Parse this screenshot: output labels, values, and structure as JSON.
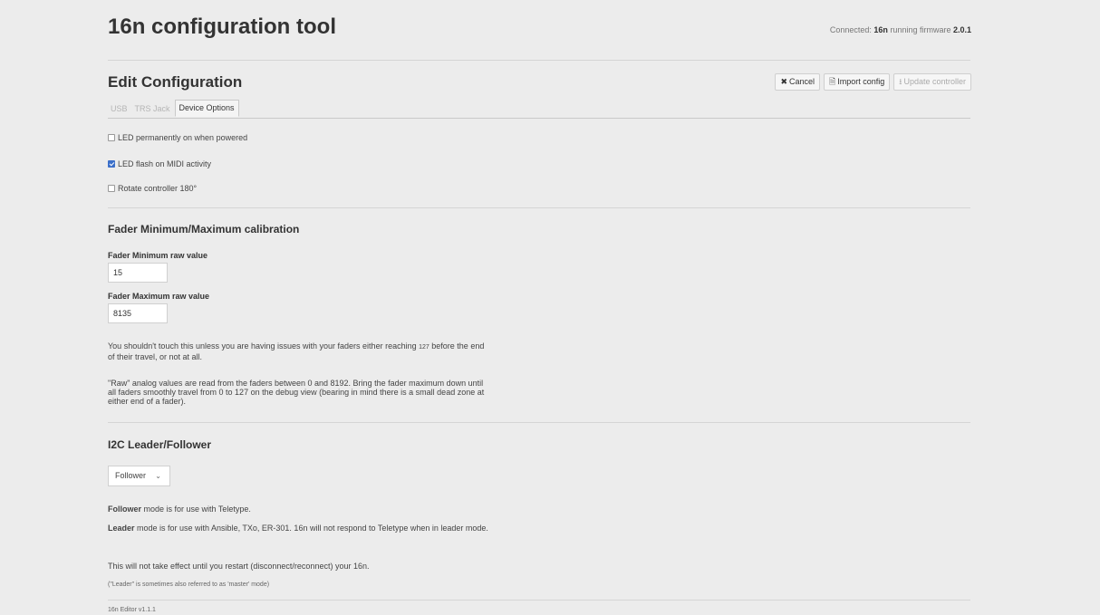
{
  "header": {
    "title": "16n configuration tool",
    "connection_prefix": "Connected: ",
    "device_name": "16n",
    "connection_middle": " running firmware ",
    "firmware_version": "2.0.1"
  },
  "edit": {
    "title": "Edit Configuration",
    "toolbar": {
      "cancel_icon": "✖",
      "cancel_label": "Cancel",
      "import_icon": "🗎",
      "import_label": "Import config",
      "update_icon": "⭳",
      "update_label": "Update controller"
    },
    "tabs": [
      {
        "label": "USB",
        "active": false
      },
      {
        "label": "TRS Jack",
        "active": false
      },
      {
        "label": "Device Options",
        "active": true
      }
    ]
  },
  "options": [
    {
      "label": "LED permanently on when powered",
      "checked": false
    },
    {
      "label": "LED flash on MIDI activity",
      "checked": true
    },
    {
      "label": "Rotate controller 180°",
      "checked": false
    }
  ],
  "calibration": {
    "title": "Fader Minimum/Maximum calibration",
    "min_label": "Fader Minimum raw value",
    "min_value": "15",
    "max_label": "Fader Maximum raw value",
    "max_value": "8135",
    "help1_before": "You shouldn't touch this unless you are having issues with your faders either reaching ",
    "help1_code": "127",
    "help1_after": " before the end of their travel, or not at all.",
    "help2": "\"Raw\" analog values are read from the faders between 0 and 8192. Bring the fader maximum down until all faders smoothly travel from 0 to 127 on the debug view (bearing in mind there is a small dead zone at either end of a fader)."
  },
  "i2c": {
    "title": "I2C Leader/Follower",
    "mode_value": "Follower",
    "follower_bold": "Follower",
    "follower_text": " mode is for use with Teletype.",
    "leader_bold": "Leader",
    "leader_text": " mode is for use with Ansible, TXo, ER-301. 16n will not respond to Teletype when in leader mode.",
    "restart_note": "This will not take effect until you restart (disconnect/reconnect) your 16n.",
    "master_note": "(\"Leader\" is sometimes also referred to as 'master' mode)"
  },
  "footer": {
    "version": "16n Editor v1.1.1"
  }
}
